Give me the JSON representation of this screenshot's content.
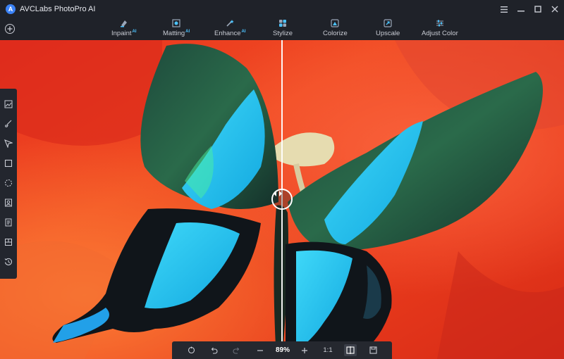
{
  "app": {
    "title": "AVCLabs PhotoPro AI",
    "logo_letter": "A"
  },
  "window_controls": [
    "menu-icon",
    "minimize-icon",
    "maximize-icon",
    "close-icon"
  ],
  "toolbar": {
    "add_icon": "plus-circle-icon",
    "tools": [
      {
        "label": "Inpaint",
        "badge": "AI",
        "icon": "inpaint-icon"
      },
      {
        "label": "Matting",
        "badge": "AI",
        "icon": "matting-icon"
      },
      {
        "label": "Enhance",
        "badge": "AI",
        "icon": "enhance-icon"
      },
      {
        "label": "Stylize",
        "badge": "",
        "icon": "stylize-icon"
      },
      {
        "label": "Colorize",
        "badge": "",
        "icon": "colorize-icon"
      },
      {
        "label": "Upscale",
        "badge": "",
        "icon": "upscale-icon"
      },
      {
        "label": "Adjust Color",
        "badge": "",
        "icon": "adjust-color-icon"
      }
    ]
  },
  "side_panel": {
    "tools": [
      "image-icon",
      "brush-icon",
      "select-arrow-icon",
      "rectangle-select-icon",
      "lasso-icon",
      "portrait-icon",
      "document-icon",
      "layers-icon",
      "history-icon"
    ]
  },
  "bottom_bar": {
    "zoom": "89%",
    "ratio": "1:1",
    "icons": [
      "reset-icon",
      "undo-icon",
      "redo-icon",
      "zoom-out-icon",
      "zoom-in-icon",
      "compare-icon",
      "save-icon"
    ]
  },
  "colors": {
    "accent": "#4cc3ff",
    "titlebar": "#1f2229",
    "panel": "#23262e",
    "wing_blue": "#27c8f0",
    "wing_green": "#1f5a44"
  }
}
